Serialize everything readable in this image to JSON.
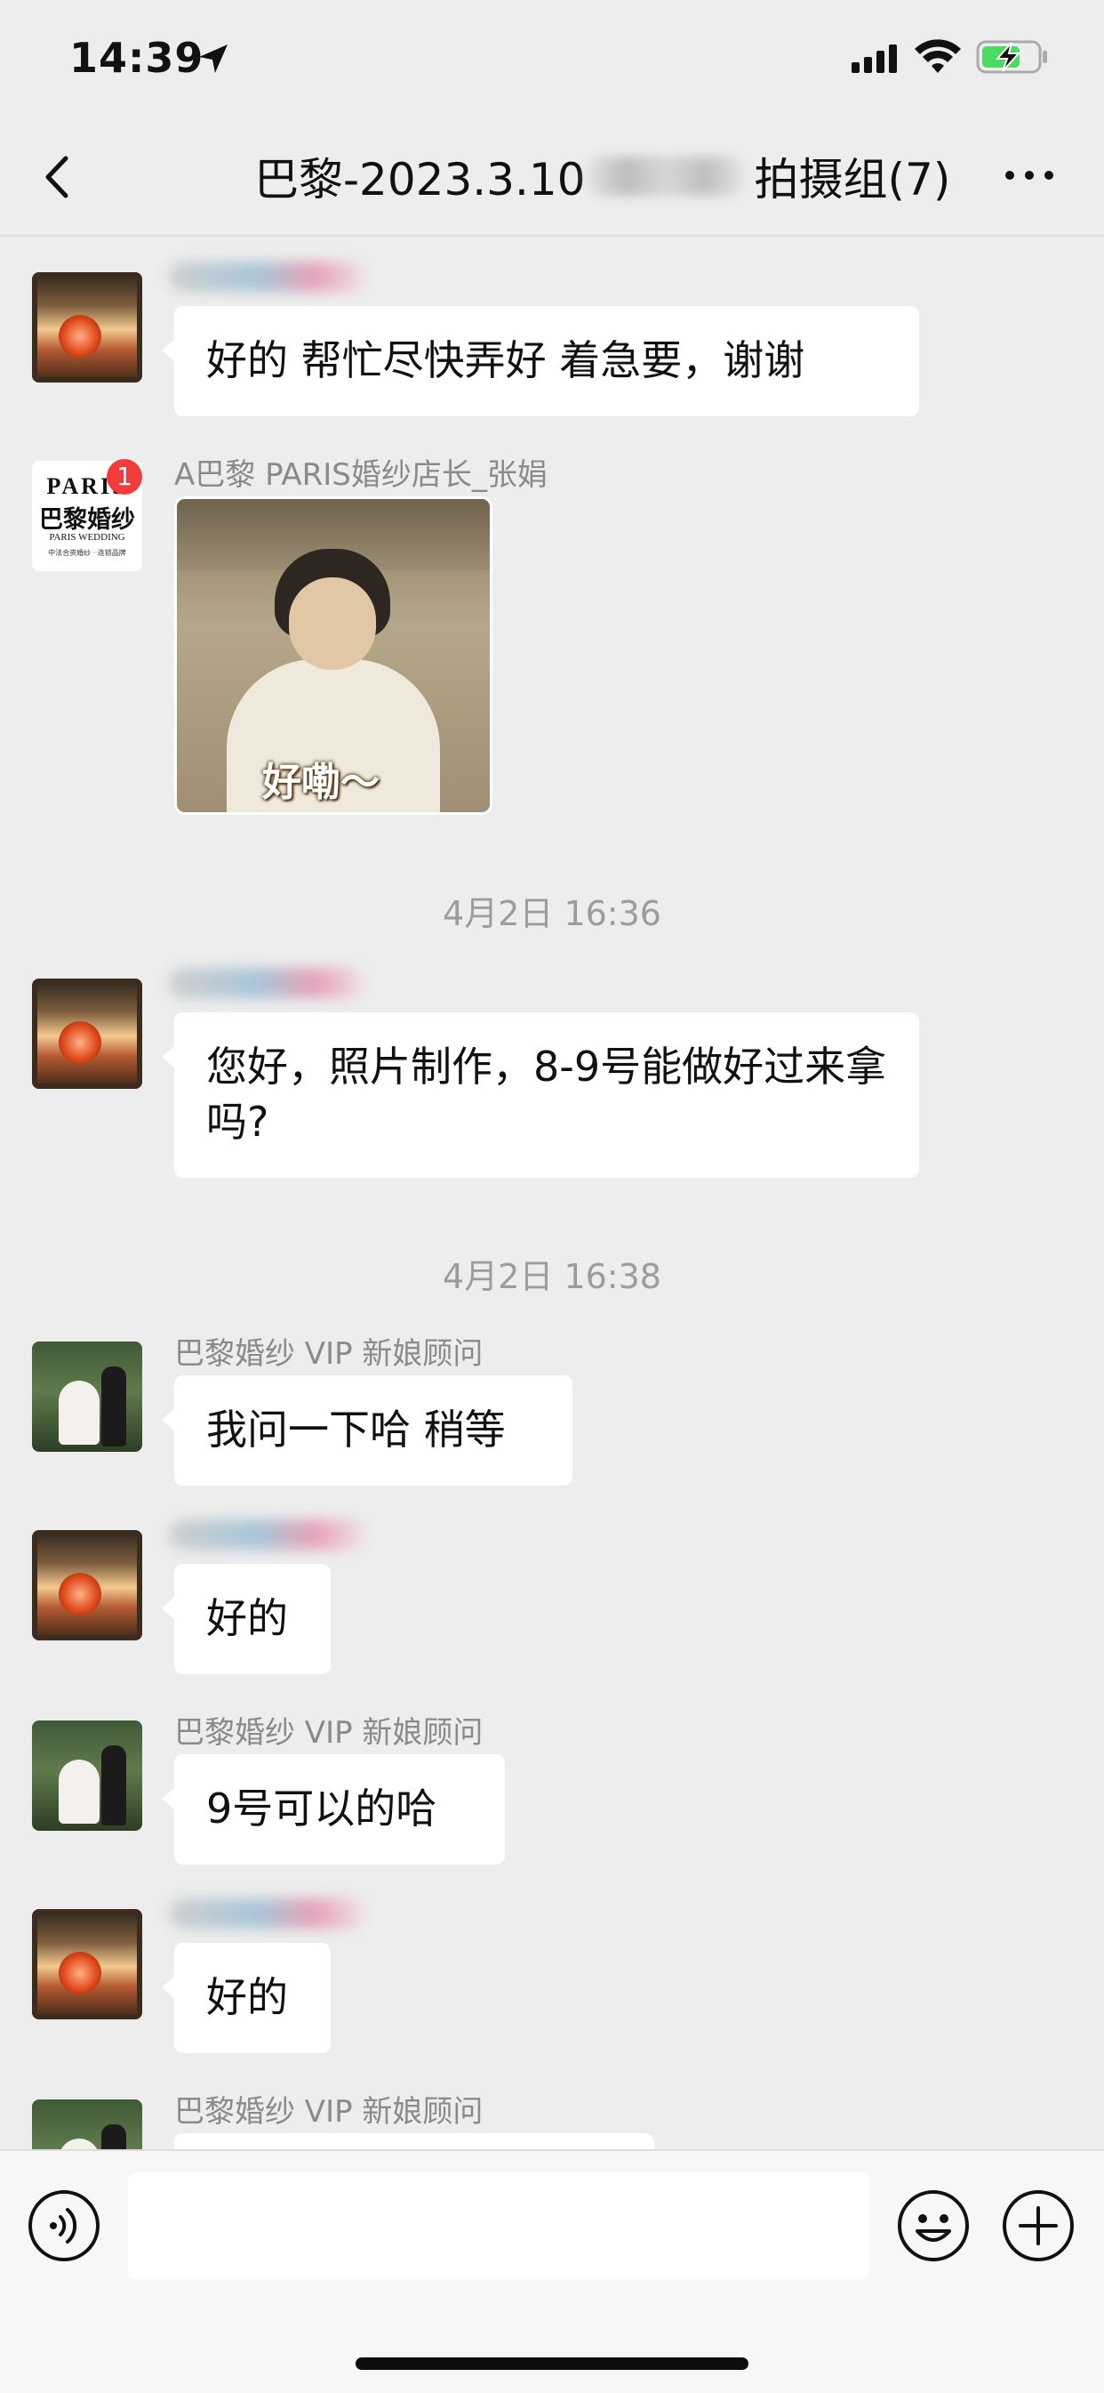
{
  "status_bar": {
    "time": "14:39"
  },
  "nav": {
    "title_prefix": "巴黎-2023.3.10",
    "title_suffix": "拍摄组(7)"
  },
  "messages": [
    {
      "sender": "",
      "text": "好的 帮忙尽快弄好  着急要，谢谢"
    },
    {
      "sender": "A巴黎 PARIS婚纱店长_张娟",
      "badge": "1",
      "sticker_text": "好嘞～"
    },
    {
      "timestamp": "4月2日 16:36"
    },
    {
      "sender": "",
      "text": "您好，照片制作，8-9号能做好过来拿吗?"
    },
    {
      "timestamp": "4月2日 16:38"
    },
    {
      "sender": "巴黎婚纱 VIP 新娘顾问",
      "text": "我问一下哈 稍等"
    },
    {
      "sender": "",
      "text": "好的"
    },
    {
      "sender": "巴黎婚纱 VIP 新娘顾问",
      "text": "9号可以的哈"
    },
    {
      "sender": "",
      "text": "好的"
    },
    {
      "sender": "巴黎婚纱 VIP 新娘顾问",
      "text": ""
    }
  ],
  "paris_logo": {
    "top": "PARIS",
    "cn": "巴黎婚纱",
    "en": "PARIS WEDDING",
    "sub": "中法合资婚纱 · 连锁品牌"
  },
  "input": {
    "placeholder": ""
  }
}
